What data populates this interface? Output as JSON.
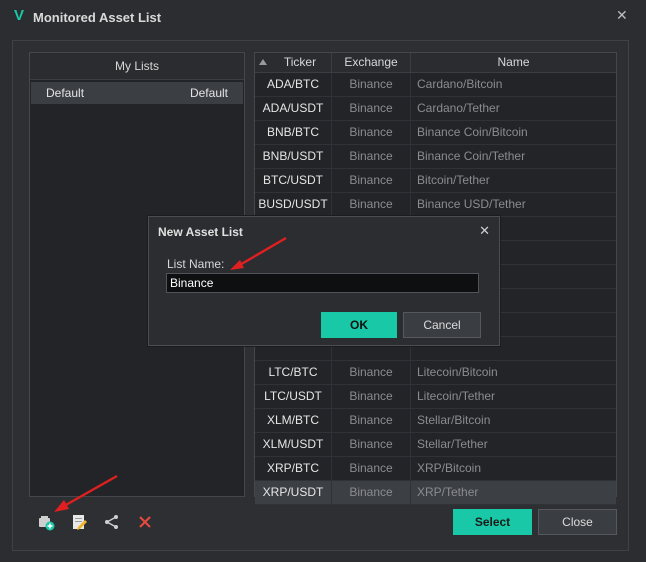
{
  "window": {
    "title": "Monitored Asset List",
    "logo": "V",
    "close_glyph": "✕"
  },
  "my_lists": {
    "header": "My Lists",
    "rows": [
      {
        "name": "Default",
        "type": "Default"
      }
    ]
  },
  "assets": {
    "columns": {
      "ticker": "Ticker",
      "exchange": "Exchange",
      "name": "Name"
    },
    "rows": [
      {
        "ticker": "ADA/BTC",
        "exchange": "Binance",
        "name": "Cardano/Bitcoin"
      },
      {
        "ticker": "ADA/USDT",
        "exchange": "Binance",
        "name": "Cardano/Tether"
      },
      {
        "ticker": "BNB/BTC",
        "exchange": "Binance",
        "name": "Binance Coin/Bitcoin"
      },
      {
        "ticker": "BNB/USDT",
        "exchange": "Binance",
        "name": "Binance Coin/Tether"
      },
      {
        "ticker": "BTC/USDT",
        "exchange": "Binance",
        "name": "Bitcoin/Tether"
      },
      {
        "ticker": "BUSD/USDT",
        "exchange": "Binance",
        "name": "Binance USD/Tether"
      },
      {
        "ticker": "",
        "exchange": "",
        "name": ""
      },
      {
        "ticker": "",
        "exchange": "",
        "name": ""
      },
      {
        "ticker": "",
        "exchange": "",
        "name": ""
      },
      {
        "ticker": "",
        "exchange": "",
        "name": ""
      },
      {
        "ticker": "",
        "exchange": "",
        "name": ""
      },
      {
        "ticker": "",
        "exchange": "",
        "name": ""
      },
      {
        "ticker": "LTC/BTC",
        "exchange": "Binance",
        "name": "Litecoin/Bitcoin"
      },
      {
        "ticker": "LTC/USDT",
        "exchange": "Binance",
        "name": "Litecoin/Tether"
      },
      {
        "ticker": "XLM/BTC",
        "exchange": "Binance",
        "name": "Stellar/Bitcoin"
      },
      {
        "ticker": "XLM/USDT",
        "exchange": "Binance",
        "name": "Stellar/Tether"
      },
      {
        "ticker": "XRP/BTC",
        "exchange": "Binance",
        "name": "XRP/Bitcoin"
      },
      {
        "ticker": "XRP/USDT",
        "exchange": "Binance",
        "name": "XRP/Tether"
      }
    ],
    "selected_index": 17
  },
  "toolbar": {
    "icons": [
      "add-list-icon",
      "edit-list-icon",
      "share-icon",
      "delete-icon"
    ]
  },
  "buttons": {
    "select": "Select",
    "close": "Close"
  },
  "dialog": {
    "title": "New Asset List",
    "label": "List Name:",
    "value": "Binance",
    "ok": "OK",
    "cancel": "Cancel",
    "close_glyph": "✕"
  },
  "colors": {
    "accent": "#19c8a6",
    "annotation_arrow": "#e02020",
    "background": "#2b2d30"
  }
}
